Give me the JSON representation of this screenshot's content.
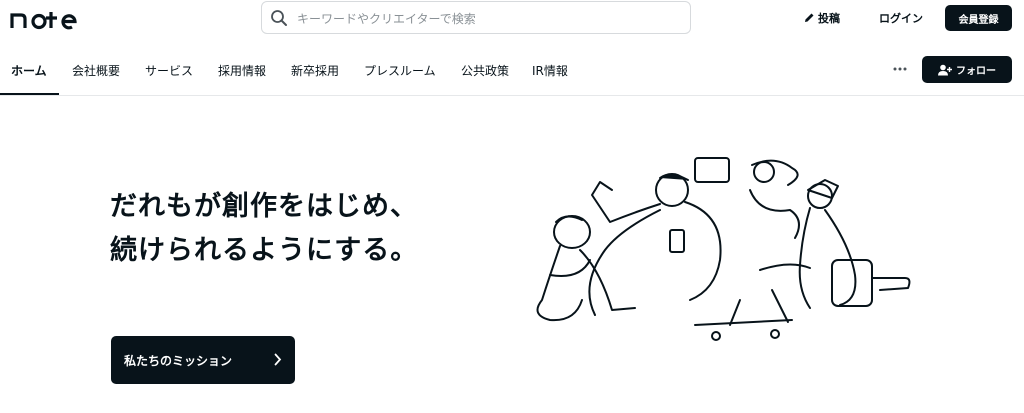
{
  "header": {
    "logo_text": "note",
    "search_placeholder": "キーワードやクリエイターで検索",
    "post_label": "投稿",
    "login_label": "ログイン",
    "signup_label": "会員登録"
  },
  "nav": {
    "tabs": [
      {
        "label": "ホーム",
        "active": true
      },
      {
        "label": "会社概要",
        "active": false
      },
      {
        "label": "サービス",
        "active": false
      },
      {
        "label": "採用情報",
        "active": false
      },
      {
        "label": "新卒採用",
        "active": false
      },
      {
        "label": "プレスルーム",
        "active": false
      },
      {
        "label": "公共政策",
        "active": false
      },
      {
        "label": "IR情報",
        "active": false
      }
    ],
    "follow_label": "フォロー"
  },
  "hero": {
    "title_line1": "だれもが創作をはじめ、",
    "title_line2": "続けられるようにする。",
    "mission_button": "私たちのミッション"
  },
  "colors": {
    "primary": "#08131a",
    "border": "#e6e8ea",
    "placeholder": "#8a9196"
  }
}
